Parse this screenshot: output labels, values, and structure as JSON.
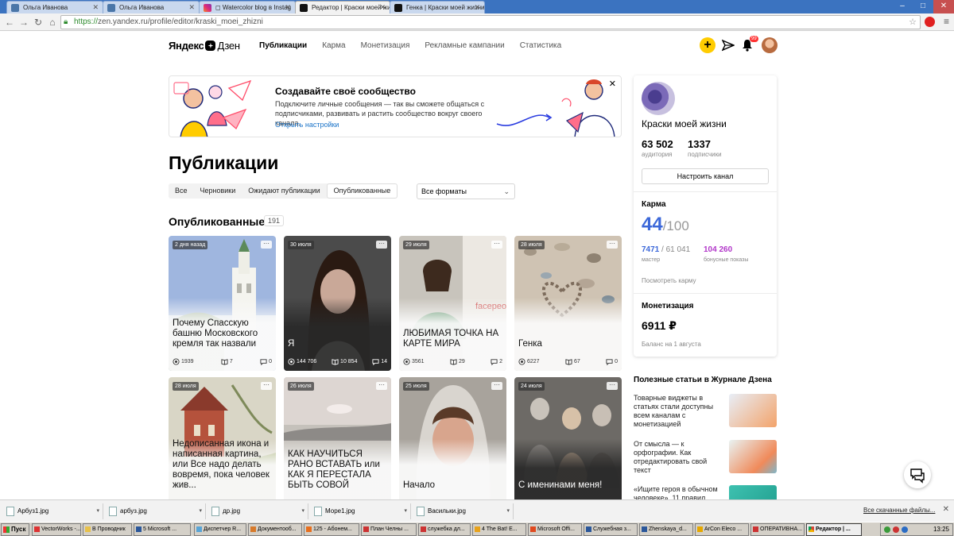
{
  "browser": {
    "tabs": [
      {
        "title": "Ольга Иванова",
        "left": 0
      },
      {
        "title": "Ольга Иванова",
        "left": 0
      },
      {
        "title": "◻ Watercolor blog в Instag",
        "left": 0
      },
      {
        "title": "Редактор | Краски моей жи",
        "left": 0
      },
      {
        "title": "Генка | Краски моей жизни",
        "left": 0
      }
    ],
    "url_protocol": "https://",
    "url_rest": "zen.yandex.ru/profile/editor/kraski_moei_zhizni"
  },
  "header": {
    "logo_first": "Яндекс",
    "logo_second": "Дзен",
    "nav": [
      "Публикации",
      "Карма",
      "Монетизация",
      "Рекламные кампании",
      "Статистика"
    ],
    "plus": "+",
    "notif_count": "99"
  },
  "banner": {
    "title": "Создавайте своё сообщество",
    "text": "Подключите личные сообщения — так вы сможете общаться с подписчиками, развивать и растить сообщество вокруг своего канала.",
    "link": "Открыть настройки",
    "close": "✕"
  },
  "main": {
    "title": "Публикации",
    "filters": [
      "Все",
      "Черновики",
      "Ожидают публикации",
      "Опубликованные"
    ],
    "format_select": "Все форматы",
    "section_title": "Опубликованные",
    "section_count": "191"
  },
  "cards": [
    {
      "date": "2 дня назад",
      "title": "Почему Спасскую башню Московского кремля так назвали",
      "views": "1939",
      "reads": "7",
      "comments": "0"
    },
    {
      "date": "30 июля",
      "title": "Я",
      "views": "144 706",
      "reads": "10 854",
      "comments": "14"
    },
    {
      "date": "29 июля",
      "title": "ЛЮБИМАЯ ТОЧКА НА КАРТЕ МИРА",
      "views": "3561",
      "reads": "29",
      "comments": "2"
    },
    {
      "date": "28 июля",
      "title": "Генка",
      "views": "6227",
      "reads": "67",
      "comments": "0"
    },
    {
      "date": "28 июля",
      "title": "Недописанная икона и написанная картина, или Все надо делать вовремя, пока человек жив...",
      "views": "",
      "reads": "",
      "comments": ""
    },
    {
      "date": "26 июля",
      "title": "КАК НАУЧИТЬСЯ РАНО ВСТАВАТЬ или КАК Я ПЕРЕСТАЛА БЫТЬ СОВОЙ",
      "views": "",
      "reads": "",
      "comments": ""
    },
    {
      "date": "25 июля",
      "title": "Начало",
      "views": "",
      "reads": "",
      "comments": ""
    },
    {
      "date": "24 июля",
      "title": "С именинами меня!",
      "views": "",
      "reads": "",
      "comments": ""
    }
  ],
  "card_more": "···",
  "card_photo_word": "facepeo",
  "sidebar": {
    "channel_name": "Краски моей жизни",
    "audience": "63 502",
    "audience_label": "аудитория",
    "subscribers": "1337",
    "subscribers_label": "подписчики",
    "setup_button": "Настроить канал",
    "karma_title": "Карма",
    "karma_value": "44",
    "karma_max": "/100",
    "master_value": "7471",
    "master_total": " / 61 041",
    "master_label": "мастер",
    "bonus_value": "104 260",
    "bonus_label": "бонусные показы",
    "karma_link": "Посмотреть карму",
    "monet_title": "Монетизация",
    "monet_value": "6911 ₽",
    "monet_label": "Баланс на 1 августа"
  },
  "journal": {
    "title": "Полезные статьи в Журнале Дзена",
    "items": [
      "Товарные виджеты в статьях стали доступны всем каналам с монетизацией",
      "От смысла — к орфографии. Как отредактировать свой текст",
      "«Ищите героя в обычном человеке». 11 правил"
    ]
  },
  "downloads": {
    "items": [
      "Арбуз1.jpg",
      "арбуз.jpg",
      "др.jpg",
      "Море1.jpg",
      "Васильки.jpg"
    ],
    "show_all": "Все скачанные файлы...",
    "close": "✕"
  },
  "taskbar": {
    "start": "Пуск",
    "tasks": [
      "VectorWorks -...",
      "В Проводник",
      "5 Microsoft ...",
      "Диспетчер R...",
      "Документооб...",
      "125 - Абонем...",
      "План Челны ...",
      "служебка дл...",
      "4 The Bat! E...",
      "Microsoft Offi...",
      "Служебная з...",
      "Zhenskaya_d...",
      "ArCon Eleco ...",
      "ОПЕРАТИВНА...",
      "Редактор | ..."
    ],
    "time": "13:25"
  },
  "colors": {
    "accent": "#3c68d9",
    "bonus": "#b136c9",
    "yellow": "#ffcc00"
  }
}
